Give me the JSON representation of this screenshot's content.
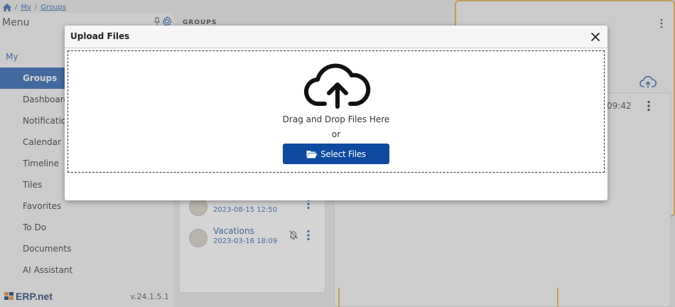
{
  "breadcrumb": {
    "items": [
      "My",
      "Groups"
    ]
  },
  "sidebar": {
    "title": "Menu",
    "section": "My",
    "items": [
      {
        "label": "Groups",
        "active": true
      },
      {
        "label": "Dashboards"
      },
      {
        "label": "Notifications"
      },
      {
        "label": "Calendar"
      },
      {
        "label": "Timeline"
      },
      {
        "label": "Tiles"
      },
      {
        "label": "Favorites"
      },
      {
        "label": "To Do"
      },
      {
        "label": "Documents"
      },
      {
        "label": "AI Assistant"
      }
    ],
    "footer": {
      "logo": "ERP.net",
      "version": "v.24.1.5.1"
    }
  },
  "groups": {
    "title": "GROUPS",
    "items": [
      {
        "name": "",
        "date": "2023-08-15 12:50"
      },
      {
        "name": "Vacations",
        "date": "2023-03-16 18:09"
      }
    ]
  },
  "right_panel": {
    "time": "09:42"
  },
  "modal": {
    "title": "Upload Files",
    "drop_text": "Drag and Drop Files Here",
    "or_text": "or",
    "select_button": "Select Files"
  },
  "colors": {
    "accent": "#2a64b0",
    "button": "#0d4aa0",
    "highlight": "#e0b24c"
  },
  "icons": [
    "home-icon",
    "pin-icon",
    "gear-icon",
    "close-icon",
    "cloud-upload-icon",
    "folder-open-icon",
    "bell-off-icon",
    "kebab-icon"
  ]
}
